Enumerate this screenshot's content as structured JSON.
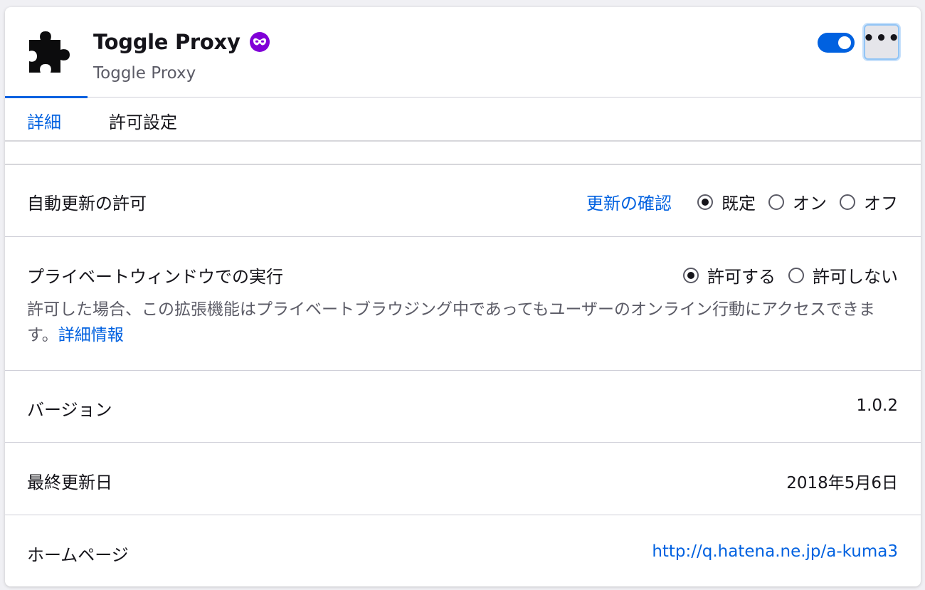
{
  "addon": {
    "name": "Toggle Proxy",
    "creator": "Toggle Proxy",
    "icon": "puzzle-piece-icon",
    "badge_icon": "private-browsing-mask-icon",
    "enabled": true,
    "more_label": "•••"
  },
  "tabs": {
    "details": "詳細",
    "permissions": "許可設定"
  },
  "auto_update": {
    "label": "自動更新の許可",
    "check_link": "更新の確認",
    "options": [
      "既定",
      "オン",
      "オフ"
    ],
    "selected": "既定"
  },
  "private_browsing": {
    "label": "プライベートウィンドウでの実行",
    "options": [
      "許可する",
      "許可しない"
    ],
    "selected": "許可する",
    "description": "許可した場合、この拡張機能はプライベートブラウジング中であってもユーザーのオンライン行動にアクセスできます。",
    "learn_more": "詳細情報"
  },
  "version": {
    "label": "バージョン",
    "value": "1.0.2"
  },
  "last_updated": {
    "label": "最終更新日",
    "value": "2018年5月6日"
  },
  "homepage": {
    "label": "ホームページ",
    "url": "http://q.hatena.ne.jp/a-kuma3"
  },
  "colors": {
    "accent": "#0061e0",
    "badge": "#8000d7",
    "text": "#15141a",
    "secondary_text": "#5b5b66"
  }
}
